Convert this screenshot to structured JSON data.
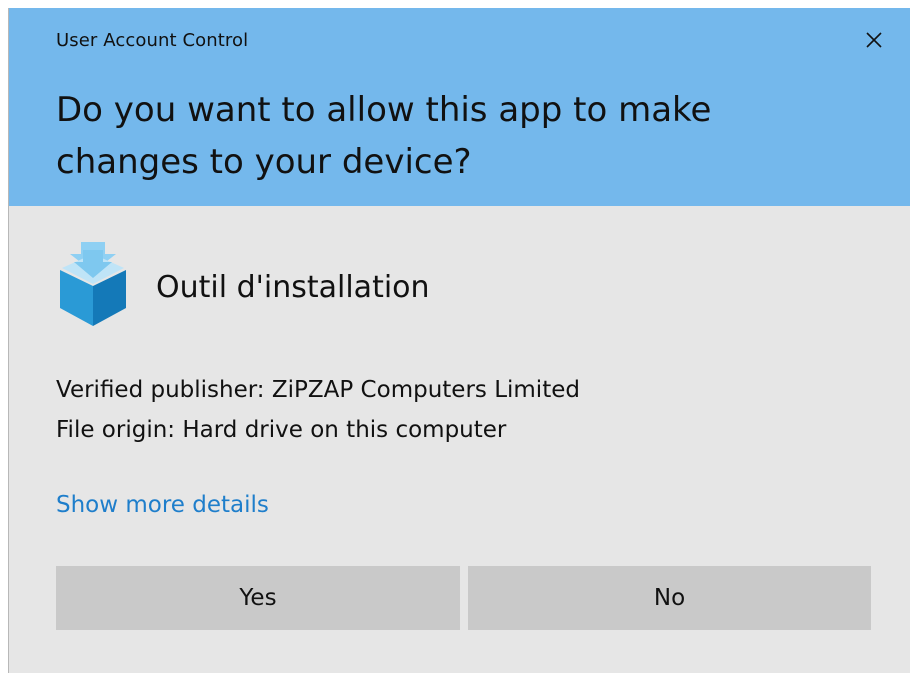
{
  "dialog": {
    "window_title": "User Account Control",
    "prompt": "Do you want to allow this app to make changes to your device?",
    "app_name": "Outil d'installation",
    "publisher_line": "Verified publisher: ZiPZAP Computers Limited",
    "origin_line": "File origin: Hard drive on this computer",
    "more_details_label": "Show more details",
    "yes_label": "Yes",
    "no_label": "No",
    "close_icon": "close-icon",
    "app_icon": "installer-box-icon"
  },
  "colors": {
    "header_bg": "#74b8ec",
    "body_bg": "#e6e6e6",
    "button_bg": "#c9c9c9",
    "link": "#1e7ecb"
  }
}
